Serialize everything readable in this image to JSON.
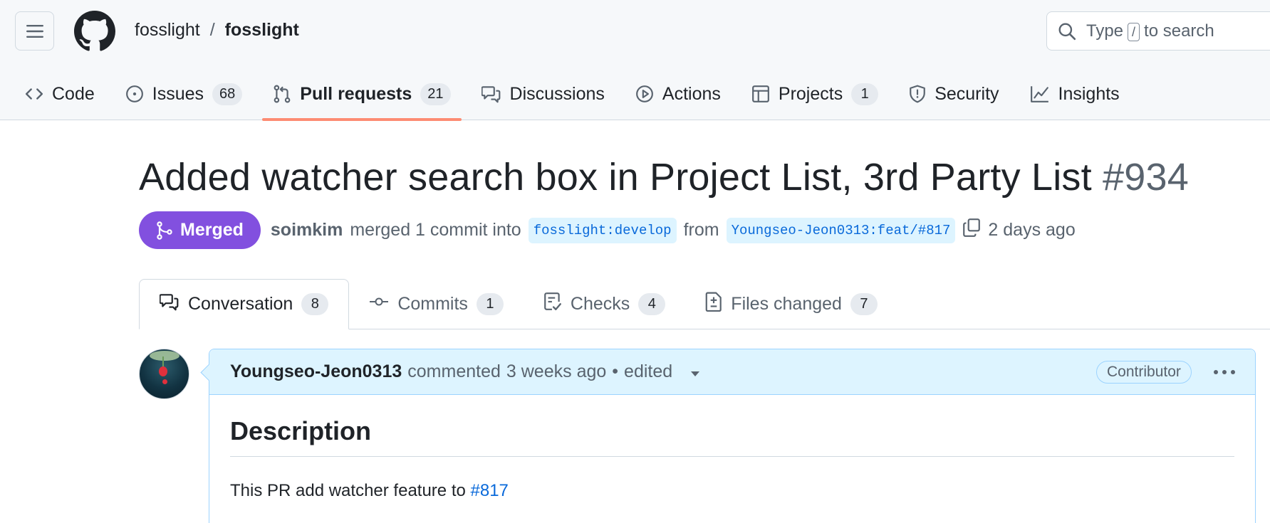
{
  "header": {
    "owner": "fosslight",
    "separator": "/",
    "repo": "fosslight",
    "search": {
      "prefix": "Type",
      "key": "/",
      "suffix": "to search"
    }
  },
  "repo_nav": [
    {
      "label": "Code",
      "icon": "code-icon"
    },
    {
      "label": "Issues",
      "count": "68",
      "icon": "issue-icon"
    },
    {
      "label": "Pull requests",
      "count": "21",
      "icon": "pull-request-icon",
      "active": true
    },
    {
      "label": "Discussions",
      "icon": "discussions-icon"
    },
    {
      "label": "Actions",
      "icon": "play-icon"
    },
    {
      "label": "Projects",
      "count": "1",
      "icon": "table-icon"
    },
    {
      "label": "Security",
      "icon": "shield-icon"
    },
    {
      "label": "Insights",
      "icon": "graph-icon"
    }
  ],
  "pr": {
    "title": "Added watcher search box in Project List, 3rd Party List",
    "number": "#934",
    "status": "Merged",
    "author": "soimkim",
    "merged_text": "merged 1 commit into",
    "base_branch": "fosslight:develop",
    "from_text": "from",
    "head_branch": "Youngseo-Jeon0313:feat/#817",
    "time": "2 days ago"
  },
  "tabs": [
    {
      "label": "Conversation",
      "count": "8",
      "icon": "comment-discussion-icon",
      "active": true
    },
    {
      "label": "Commits",
      "count": "1",
      "icon": "commit-icon"
    },
    {
      "label": "Checks",
      "count": "4",
      "icon": "checklist-icon"
    },
    {
      "label": "Files changed",
      "count": "7",
      "icon": "file-diff-icon"
    }
  ],
  "comment": {
    "author": "Youngseo-Jeon0313",
    "action": "commented",
    "time": "3 weeks ago",
    "bullet": "•",
    "edited": "edited",
    "role": "Contributor",
    "heading": "Description",
    "body_text": "This PR add watcher feature to",
    "body_link": "#817"
  },
  "colors": {
    "merged": "#8250df",
    "active_underline": "#fd8c73",
    "link": "#0969da",
    "comment_header_bg": "#ddf4ff"
  }
}
